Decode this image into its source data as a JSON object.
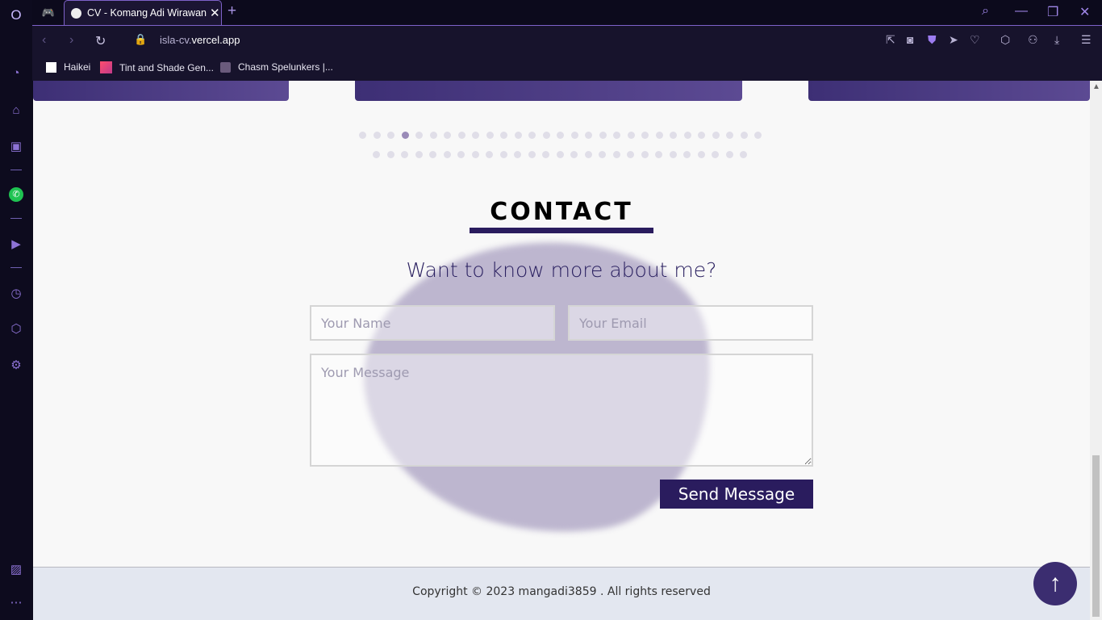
{
  "browser": {
    "tab_title": "CV - Komang Adi Wirawan",
    "new_tab": "+",
    "url_prefix": "isla-cv.",
    "url_domain": "vercel.app",
    "bookmarks": [
      {
        "label": "Haikei",
        "icon": "page-icon"
      },
      {
        "label": "Tint and Shade Gen...",
        "icon": "gradient-icon"
      },
      {
        "label": "Chasm Spelunkers |...",
        "icon": "game-icon"
      }
    ],
    "accent_color": "#8d73d6"
  },
  "carousel": {
    "dot_count_row1": 29,
    "dot_count_row2": 27,
    "active_index": 3
  },
  "contact": {
    "title": "CONTACT",
    "subtitle": "Want to know more about me?",
    "name_placeholder": "Your Name",
    "email_placeholder": "Your Email",
    "message_placeholder": "Your Message",
    "send_label": "Send Message"
  },
  "footer": {
    "copyright": "Copyright © 2023 mangadi3859 . All rights reserved"
  },
  "colors": {
    "brand": "#2a1c5e",
    "blob": "#bdb6cf"
  }
}
